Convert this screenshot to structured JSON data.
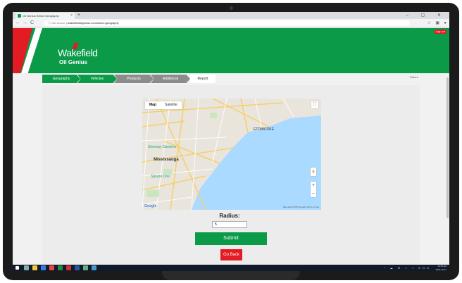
{
  "browser": {
    "tab_title": "Oil Genius Select Geography",
    "new_tab": "+",
    "window_controls": "– ▢ ✕",
    "secure_label": "Not secure",
    "url": "wakefieldoilgenius.com/select-geography",
    "nav": {
      "back": "←",
      "forward": "→",
      "reload": "C",
      "info": "ⓘ"
    }
  },
  "header": {
    "brand": "Wakefield",
    "sub": "Oil Genius",
    "logout": "Log out",
    "colors": {
      "green": "#0a9a48",
      "red": "#e31b23"
    }
  },
  "steps": {
    "items": [
      {
        "label": "Geography",
        "state": "active"
      },
      {
        "label": "Vehicles",
        "state": "active"
      },
      {
        "label": "Products",
        "state": "inactive"
      },
      {
        "label": "Additional",
        "state": "inactive"
      },
      {
        "label": "Report",
        "state": "plain"
      }
    ],
    "failure_text": "Failure"
  },
  "map": {
    "tabs": [
      "Map",
      "Satellite"
    ],
    "selected_tab": "Map",
    "labels": {
      "etobicoke": "ETOBICOKE",
      "mississauga": "Mississauga",
      "sherway": "Sherway Gardens",
      "square_one": "Square One"
    },
    "zoom_in": "+",
    "zoom_out": "–",
    "google": "Google",
    "footer": "Map data ©2019 Google   Terms of Use",
    "fullscreen_icon": "fullscreen-icon",
    "pegman_icon": "pegman-icon"
  },
  "form": {
    "radius_label": "Radius:",
    "radius_value": "5",
    "submit_label": "Submit",
    "go_back_label": "Go Back"
  },
  "taskbar": {
    "tray": "^ ☁ ✉ ◐ ◑ ENG",
    "time": "10:35 AM",
    "date": "2019-10-21"
  }
}
